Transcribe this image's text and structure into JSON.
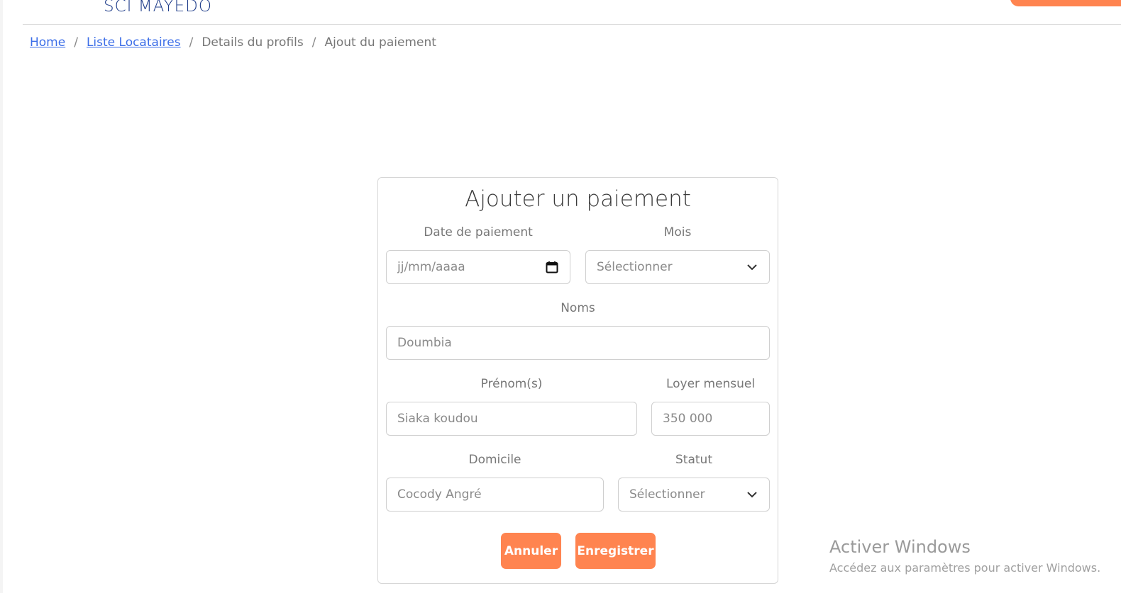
{
  "header": {
    "logo_text": "SCI MAYEDO"
  },
  "breadcrumb": {
    "items": [
      {
        "label": "Home"
      },
      {
        "label": "Liste Locataires"
      },
      {
        "label": "Details du profils"
      },
      {
        "label": "Ajout du paiement"
      }
    ],
    "separator": "/"
  },
  "form": {
    "title": "Ajouter un paiement",
    "date_label": "Date de paiement",
    "date_placeholder": "jj/mm/aaaa",
    "mois_label": "Mois",
    "mois_value": "Sélectionner",
    "noms_label": "Noms",
    "noms_placeholder": "Doumbia",
    "prenoms_label": "Prénom(s)",
    "prenoms_placeholder": "Siaka koudou",
    "loyer_label": "Loyer mensuel",
    "loyer_placeholder": "350 000",
    "domicile_label": "Domicile",
    "domicile_placeholder": "Cocody Angré",
    "statut_label": "Statut",
    "statut_value": "Sélectionner",
    "cancel_label": "Annuler",
    "save_label": "Enregistrer"
  },
  "watermark": {
    "title": "Activer Windows",
    "subtitle": "Accédez aux paramètres pour activer Windows."
  },
  "colors": {
    "accent": "#ff8450",
    "brand": "#1f3d8a",
    "link": "#3c6ee8"
  },
  "icons": {
    "calendar": "calendar-icon",
    "chevron": "chevron-down-icon"
  }
}
